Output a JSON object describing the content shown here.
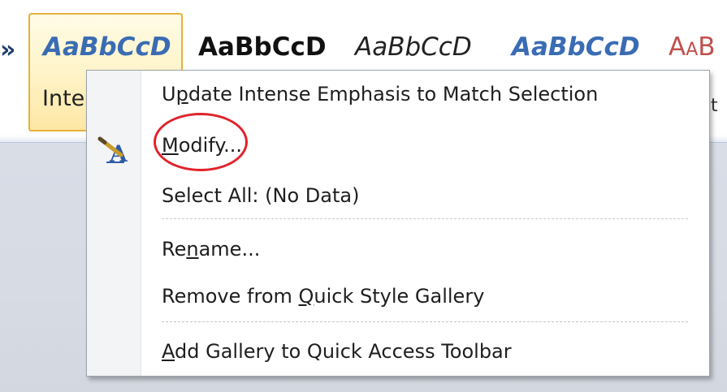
{
  "ribbon": {
    "left_partial": "»",
    "styles": [
      {
        "name": "intense-emphasis",
        "preview": "AaBbCcD",
        "caption": "Inte",
        "selected": true
      },
      {
        "name": "strong",
        "preview": "AaBbCcD"
      },
      {
        "name": "subtle-emphasis",
        "preview": "AaBbCcD"
      },
      {
        "name": "intense-emphasis-2",
        "preview": "AaBbCcD"
      },
      {
        "name": "subtle-reference",
        "preview": "AaB"
      }
    ],
    "right_partial": "t"
  },
  "menu": {
    "items": [
      {
        "label_parts": [
          "U",
          "p",
          "date Intense Emphasis to Match Selection"
        ],
        "underline_index": 1
      },
      {
        "label_parts": [
          "",
          "M",
          "odify..."
        ],
        "underline_index": 1,
        "icon": "modify-style-icon"
      },
      {
        "label_parts": [
          "Select All: (No Data)",
          "",
          ""
        ]
      },
      {
        "label_parts": [
          "Re",
          "n",
          "ame..."
        ],
        "underline_index": 1
      },
      {
        "label_parts": [
          "Remove from ",
          "Q",
          "uick Style Gallery"
        ],
        "underline_index": 1
      },
      {
        "label_parts": [
          "",
          "A",
          "dd Gallery to Quick Access Toolbar"
        ],
        "underline_index": 1
      }
    ]
  },
  "colors": {
    "accent_blue": "#3a6cb3",
    "selection_gold": "#e6b23a",
    "highlight_circle": "#e0232b"
  }
}
